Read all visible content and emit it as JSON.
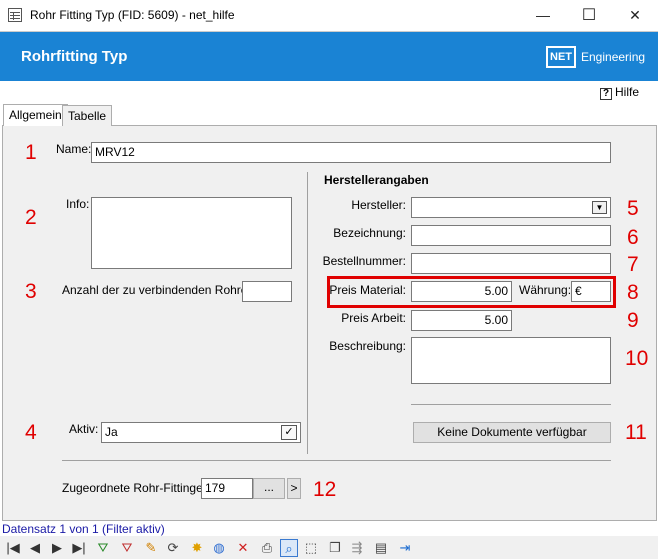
{
  "window": {
    "title": "Rohr Fitting Typ (FID: 5609) - net_hilfe",
    "minimize": "—",
    "maximize": "☐",
    "close": "✕"
  },
  "header": {
    "title": "Rohrfitting Typ",
    "logo_text": "NET",
    "logo_suffix": "Engineering",
    "brand_color": "#1a83d4"
  },
  "help": {
    "label": "Hilfe",
    "icon": "?"
  },
  "tabs": [
    {
      "label": "Allgemein",
      "active": true
    },
    {
      "label": "Tabelle",
      "active": false
    }
  ],
  "form": {
    "name_label": "Name:",
    "name_value": "MRV12",
    "info_label": "Info:",
    "info_value": "",
    "anzahl_label": "Anzahl der zu verbindenden Rohre:",
    "anzahl_value": "",
    "aktiv_label": "Aktiv:",
    "aktiv_value": "Ja",
    "aktiv_check": "✓",
    "hersteller_section": "Herstellerangaben",
    "hersteller_label": "Hersteller:",
    "hersteller_value": "",
    "hersteller_arrow": "▼",
    "bezeichnung_label": "Bezeichnung:",
    "bezeichnung_value": "",
    "bestellnummer_label": "Bestellnummer:",
    "bestellnummer_value": "",
    "preis_material_label": "Preis Material:",
    "preis_material_value": "5.00",
    "waehrung_label": "Währung:",
    "waehrung_value": "€",
    "preis_arbeit_label": "Preis Arbeit:",
    "preis_arbeit_value": "5.00",
    "beschreibung_label": "Beschreibung:",
    "beschreibung_value": "",
    "documents_button": "Keine Dokumente verfügbar",
    "zugeordnete_label": "Zugeordnete Rohr-Fittinge:",
    "zugeordnete_value": "179",
    "zugeordnete_browse": "...",
    "zugeordnete_next": ">"
  },
  "annotations": [
    "1",
    "2",
    "3",
    "4",
    "5",
    "6",
    "7",
    "8",
    "9",
    "10",
    "11",
    "12"
  ],
  "annotation_color": "#e00000",
  "status": {
    "text": "Datensatz 1 von 1 (Filter aktiv)"
  },
  "toolbar": {
    "icons": [
      {
        "name": "first-record-icon",
        "glyph": "|◀"
      },
      {
        "name": "prev-record-icon",
        "glyph": "◀"
      },
      {
        "name": "next-record-icon",
        "glyph": "▶"
      },
      {
        "name": "last-record-icon",
        "glyph": "▶|"
      },
      {
        "name": "filter-add-icon",
        "glyph": "⛛"
      },
      {
        "name": "filter-remove-icon",
        "glyph": "⛛"
      },
      {
        "name": "edit-pencil-icon",
        "glyph": "✎"
      },
      {
        "name": "refresh-icon",
        "glyph": "⟳"
      },
      {
        "name": "new-record-icon",
        "glyph": "✸"
      },
      {
        "name": "globe-icon",
        "glyph": "◍"
      },
      {
        "name": "delete-icon",
        "glyph": "✕"
      },
      {
        "name": "print-icon",
        "glyph": "⎙"
      },
      {
        "name": "zoom-icon",
        "glyph": "⌕"
      },
      {
        "name": "select-icon",
        "glyph": "⬚"
      },
      {
        "name": "copy-icon",
        "glyph": "❐"
      },
      {
        "name": "link-icon",
        "glyph": "⇶"
      },
      {
        "name": "table-edit-icon",
        "glyph": "▤"
      },
      {
        "name": "exit-icon",
        "glyph": "⇥"
      }
    ]
  }
}
